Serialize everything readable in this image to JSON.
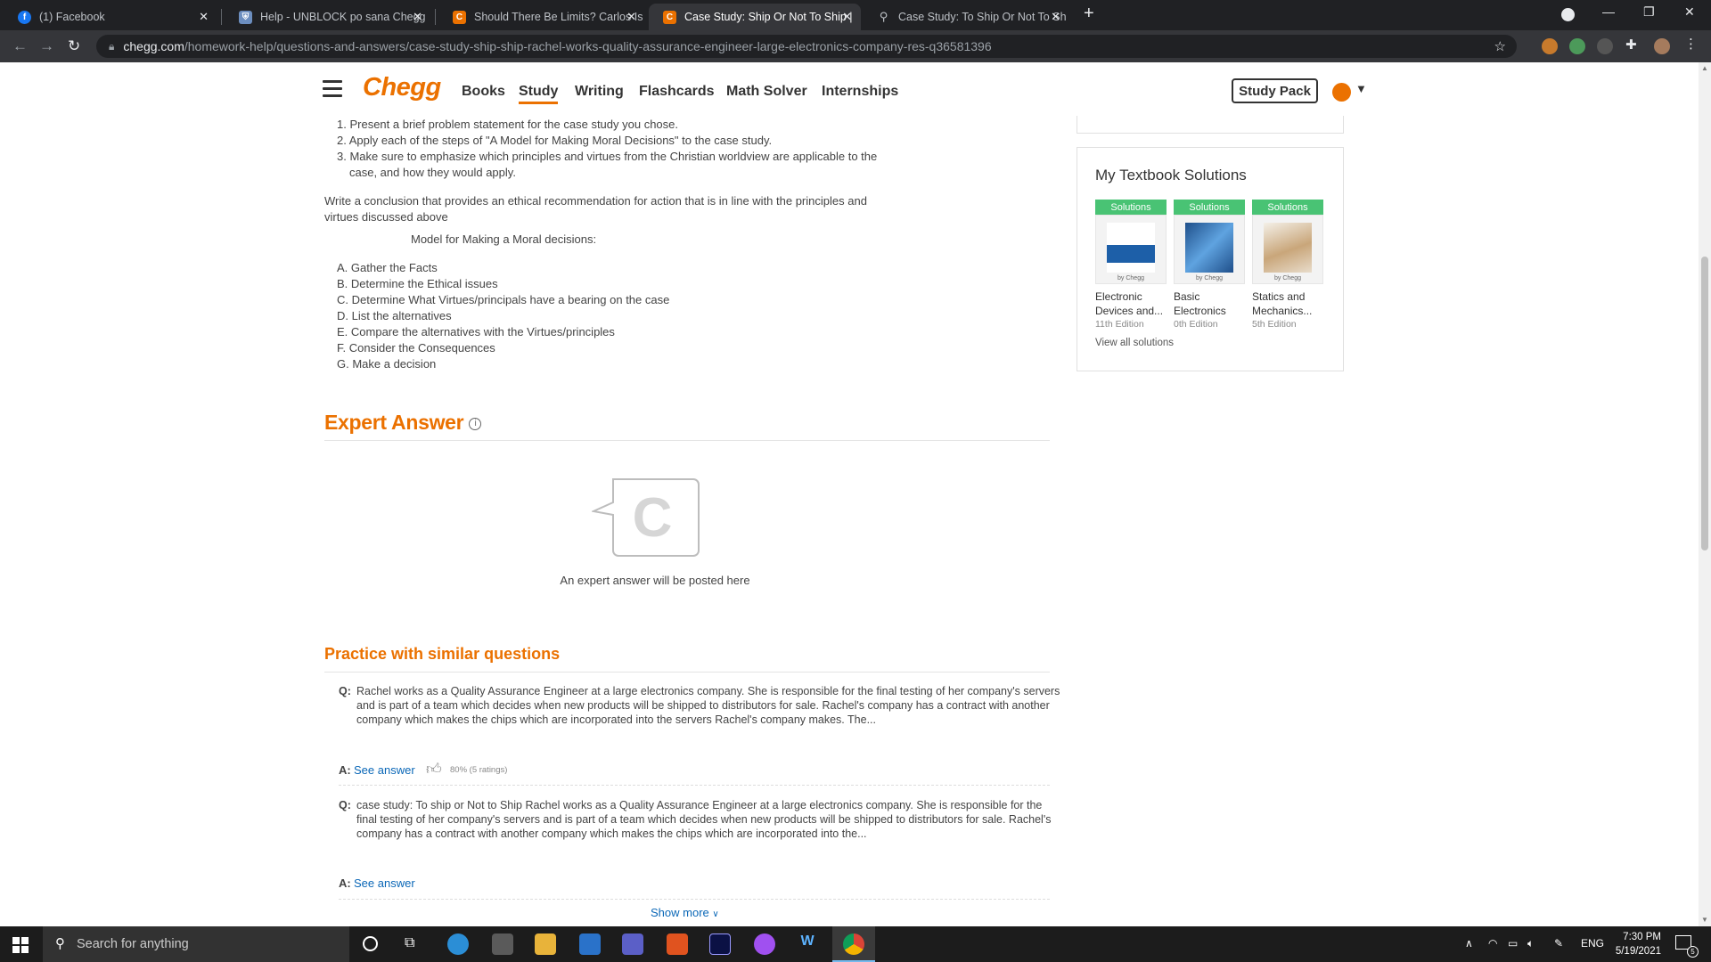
{
  "browser": {
    "tabs": [
      {
        "title": "(1) Facebook",
        "icon": "facebook-icon",
        "color": "#1877f2",
        "glyph": "f"
      },
      {
        "title": "Help - UNBLOCK po sana Chegg",
        "icon": "shield-icon",
        "color": "#6c8ebf",
        "glyph": "⛨"
      },
      {
        "title": "Should There Be Limits? Carlos Is",
        "icon": "chegg-icon",
        "color": "#eb7100",
        "glyph": "C"
      },
      {
        "title": "Case Study: Ship Or Not To Ship |",
        "icon": "chegg-icon",
        "color": "#eb7100",
        "glyph": "C"
      },
      {
        "title": "Case Study: To Ship Or Not To Sh",
        "icon": "search-icon",
        "color": "#35363a",
        "glyph": "⚲"
      }
    ],
    "url_domain": "chegg.com",
    "url_path": "/homework-help/questions-and-answers/case-study-ship-ship-rachel-works-quality-assurance-engineer-large-electronics-company-res-q36581396"
  },
  "header": {
    "logo": "Chegg",
    "nav": [
      "Books",
      "Study",
      "Writing",
      "Flashcards",
      "Math Solver",
      "Internships"
    ],
    "study_pack": "Study Pack"
  },
  "question": {
    "steps": [
      "Present a brief problem statement for the case study you chose.",
      "Apply each of the steps of \"A Model for Making Moral Decisions\" to the case study.",
      "Make sure to emphasize which principles and virtues from the Christian worldview are applicable to the",
      "case, and how they would apply."
    ],
    "conclusion_1": "Write a conclusion that provides an ethical recommendation for action that is in line with the principles and",
    "conclusion_2": "virtues discussed above",
    "model_title": "Model for Making a Moral decisions:",
    "model_steps": [
      "A. Gather the Facts",
      "B. Determine the Ethical issues",
      "C. Determine What Virtues/principals have a bearing on the case",
      "D. List the alternatives",
      "E. Compare the alternatives with the Virtues/principles",
      "F. Consider the Consequences",
      "G. Make a decision"
    ]
  },
  "expert": {
    "title": "Expert Answer",
    "placeholder": "An expert answer will be posted here"
  },
  "practice": {
    "title": "Practice with similar questions",
    "q_label": "Q:",
    "a_label": "A:",
    "items": [
      {
        "question": "Rachel works as a Quality Assurance Engineer at a large electronics company. She is responsible for the final testing of her company's servers and is part of a team which decides when new products will be shipped to distributors for sale. Rachel's company has a contract with another company which makes the chips which are incorporated into the servers Rachel's company makes. The...",
        "see_answer": "See answer",
        "rating": "80% (5 ratings)"
      },
      {
        "question": "case study: To ship or Not to Ship Rachel works as a Quality Assurance Engineer at a large electronics company. She is responsible for the final testing of her company's servers and is part of a team which decides when new products will be shipped to distributors for sale. Rachel's company has a contract with another company which makes the chips which are incorporated into the...",
        "see_answer": "See answer"
      }
    ],
    "show_more": "Show more"
  },
  "sidebar": {
    "title": "My Textbook Solutions",
    "badge": "Solutions",
    "by": "by Chegg",
    "books": [
      {
        "name": "Electronic Devices and...",
        "edition": "11th Edition",
        "color": "#1d5fa8"
      },
      {
        "name": "Basic Electronics",
        "edition": "0th Edition",
        "color": "#2a79c9"
      },
      {
        "name": "Statics and Mechanics...",
        "edition": "5th Edition",
        "color": "#c9a67a"
      }
    ],
    "view_all": "View all solutions"
  },
  "taskbar": {
    "search_placeholder": "Search for anything",
    "lang": "ENG",
    "time": "7:30 PM",
    "date": "5/19/2021",
    "notifications": "5"
  }
}
